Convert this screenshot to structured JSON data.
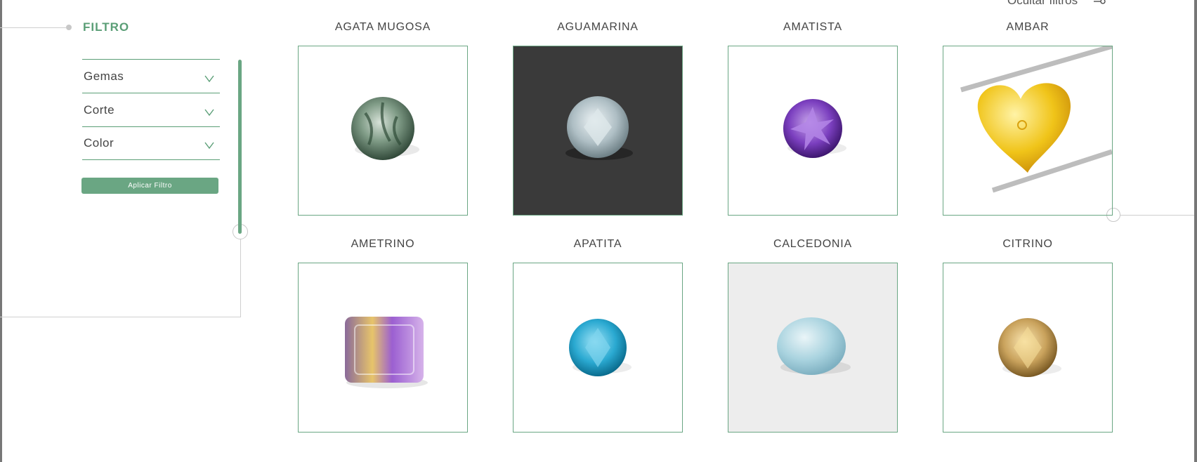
{
  "sidebar": {
    "title": "FILTRO",
    "filters": [
      {
        "label": "Gemas"
      },
      {
        "label": "Corte"
      },
      {
        "label": "Color"
      }
    ],
    "apply_label": "Aplicar Filtro"
  },
  "header": {
    "hide_filters_label": "Ocultar filtros"
  },
  "products": [
    {
      "name": "AGATA MUGOSA"
    },
    {
      "name": "AGUAMARINA"
    },
    {
      "name": "AMATISTA"
    },
    {
      "name": "AMBAR"
    },
    {
      "name": "AMETRINO"
    },
    {
      "name": "APATITA"
    },
    {
      "name": "CALCEDONIA"
    },
    {
      "name": "CITRINO"
    }
  ],
  "colors": {
    "accent": "#5a9e76",
    "button": "#6aa683",
    "border": "#6aa683"
  }
}
